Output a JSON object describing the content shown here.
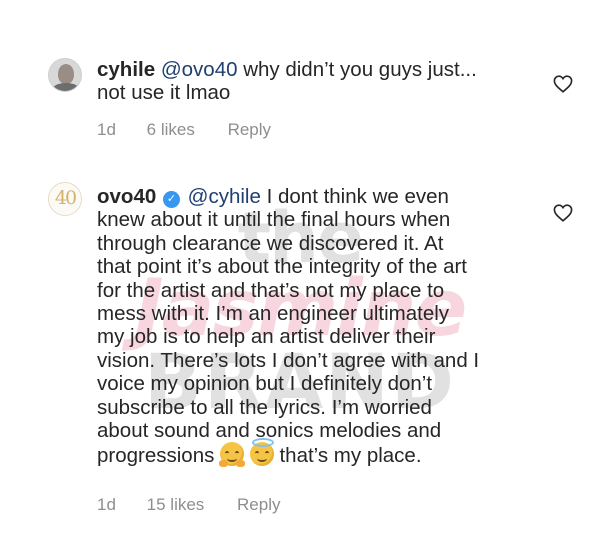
{
  "watermark": {
    "line1": "the",
    "line2": "Jasmine",
    "line3": "BRAND"
  },
  "comments": [
    {
      "username": "cyhile",
      "mention": "@ovo40",
      "text": "why didn’t you guys just...",
      "text_line2": "not use it lmao",
      "time": "1d",
      "likes": "6 likes",
      "reply": "Reply",
      "avatar_icon": "profile-photo",
      "like_icon": "heart-outline-icon"
    },
    {
      "username": "ovo40",
      "verified_icon": "verified-badge-icon",
      "mention": "@cyhile",
      "lines": [
        "I dont think we even",
        "knew about it until the final hours when",
        "through clearance we discovered it. At",
        "that point it’s about the integrity of the art",
        "for the artist and that’s not my place to",
        "mess with it. I’m an engineer ultimately",
        "my job is to help an artist deliver their",
        "vision. There’s lots I don’t agree with and I",
        "voice my opinion but I definitely don’t",
        "subscribe to all the lyrics. I’m worried",
        "about sound and sonics melodies and",
        "progressions"
      ],
      "emojis": [
        "hugging-face-emoji",
        "smiling-face-with-halo-emoji"
      ],
      "tail": "that’s my place.",
      "avatar_logo": "40",
      "time": "1d",
      "likes": "15 likes",
      "reply": "Reply",
      "like_icon": "heart-outline-icon"
    }
  ],
  "colors": {
    "text": "#262626",
    "mention": "#1f3f71",
    "meta": "#8e8e8e",
    "verified": "#3897f0"
  }
}
